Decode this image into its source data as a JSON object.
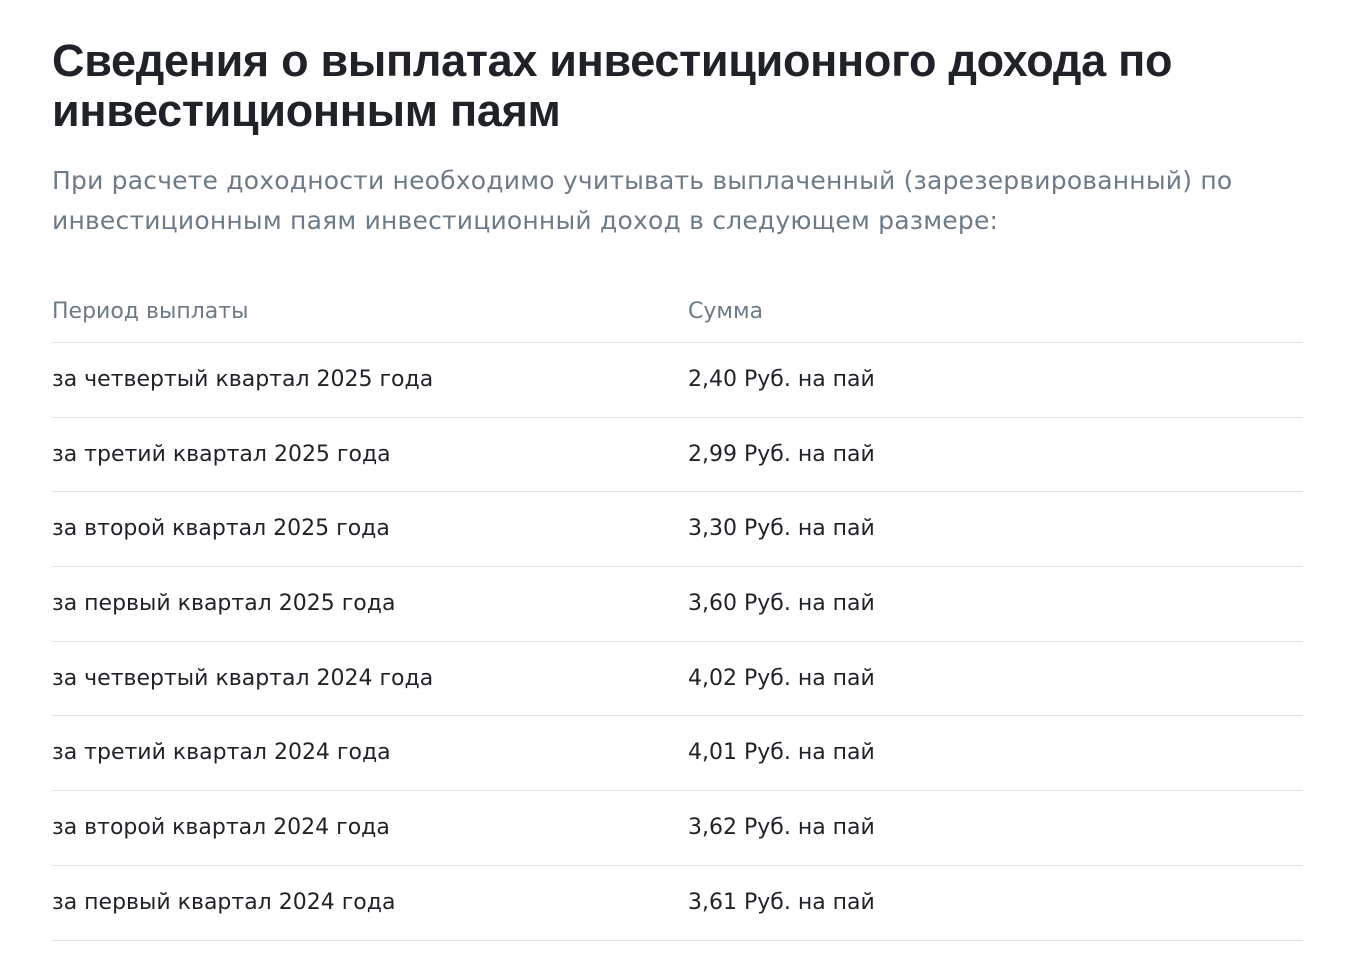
{
  "title": "Сведения о выплатах инвестиционного дохода по инвестиционным паям",
  "subtitle": "При расчете доходности необходимо учитывать выплаченный (зарезервированный) по инвестиционным паям инвестиционный доход в следующем размере:",
  "table": {
    "headers": {
      "period": "Период выплаты",
      "sum": "Сумма"
    },
    "rows": [
      {
        "period": "за четвертый квартал 2025 года",
        "sum": "2,40 Руб. на пай"
      },
      {
        "period": "за третий квартал 2025 года",
        "sum": "2,99 Руб. на пай"
      },
      {
        "period": "за второй квартал 2025 года",
        "sum": "3,30 Руб. на пай"
      },
      {
        "period": "за первый квартал 2025 года",
        "sum": "3,60 Руб. на пай"
      },
      {
        "period": "за четвертый квартал 2024 года",
        "sum": "4,02 Руб. на пай"
      },
      {
        "period": "за третий квартал 2024 года",
        "sum": "4,01 Руб. на пай"
      },
      {
        "period": "за второй квартал 2024 года",
        "sum": "3,62 Руб. на пай"
      },
      {
        "period": "за первый квартал 2024 года",
        "sum": "3,61 Руб. на пай"
      }
    ]
  }
}
